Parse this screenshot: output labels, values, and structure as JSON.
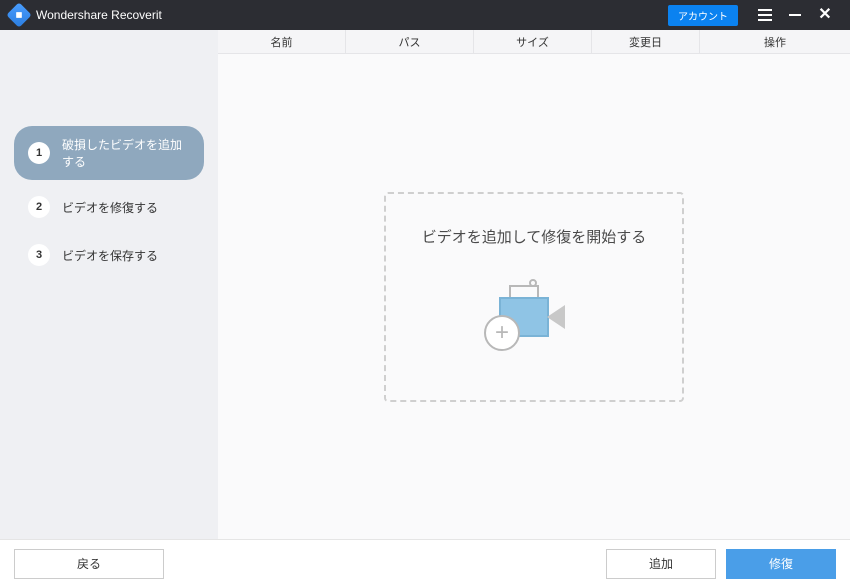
{
  "titlebar": {
    "app_name": "Wondershare Recoverit",
    "account_label": "アカウント"
  },
  "sidebar": {
    "steps": [
      {
        "num": "1",
        "label": "破損したビデオを追加する",
        "active": true
      },
      {
        "num": "2",
        "label": "ビデオを修復する",
        "active": false
      },
      {
        "num": "3",
        "label": "ビデオを保存する",
        "active": false
      }
    ]
  },
  "table": {
    "headers": {
      "name": "名前",
      "path": "パス",
      "size": "サイズ",
      "date": "変更日",
      "action": "操作"
    }
  },
  "dropzone": {
    "text": "ビデオを追加して修復を開始する"
  },
  "footer": {
    "back": "戻る",
    "add": "追加",
    "repair": "修復"
  }
}
